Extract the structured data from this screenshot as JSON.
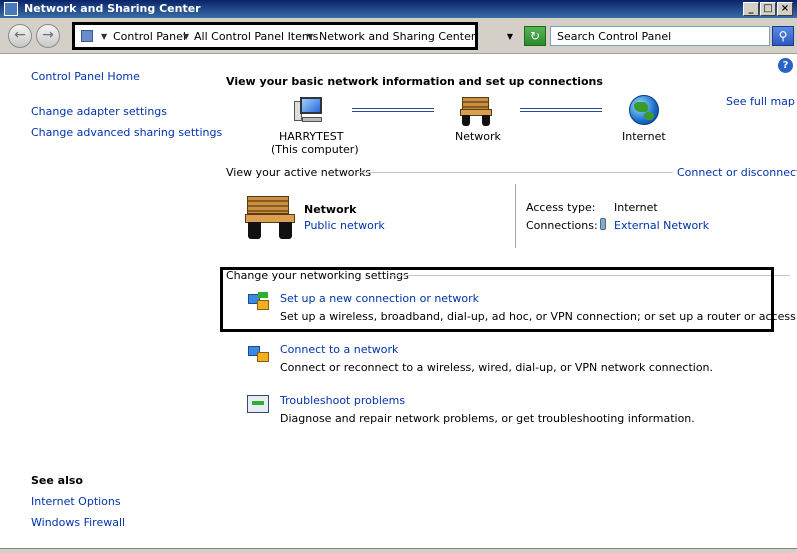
{
  "window": {
    "title": "Network and Sharing Center",
    "minimize": "_",
    "maximize": "□",
    "close": "×"
  },
  "address": {
    "crumbs": [
      "Control Panel",
      "All Control Panel Items",
      "Network and Sharing Center"
    ],
    "search_placeholder": "Search Control Panel"
  },
  "sidebar": {
    "home": "Control Panel Home",
    "items": [
      "Change adapter settings",
      "Change advanced sharing settings"
    ],
    "see_also_title": "See also",
    "see_also": [
      "Internet Options",
      "Windows Firewall"
    ]
  },
  "main": {
    "heading": "View your basic network information and set up connections",
    "see_full_map": "See full map",
    "map": {
      "computer_name": "HARRYTEST",
      "computer_sub": "(This computer)",
      "network": "Network",
      "internet": "Internet"
    },
    "active_title": "View your active networks",
    "connect_disconnect": "Connect or disconnect",
    "active": {
      "name": "Network",
      "type": "Public network",
      "access_label": "Access type:",
      "access_value": "Internet",
      "connections_label": "Connections:",
      "connections_value": "External Network"
    },
    "settings_title": "Change your networking settings",
    "tasks": [
      {
        "title": "Set up a new connection or network",
        "desc": "Set up a wireless, broadband, dial-up, ad hoc, or VPN connection; or set up a router or access point."
      },
      {
        "title": "Connect to a network",
        "desc": "Connect or reconnect to a wireless, wired, dial-up, or VPN network connection."
      },
      {
        "title": "Troubleshoot problems",
        "desc": "Diagnose and repair network problems, or get troubleshooting information."
      }
    ]
  },
  "colors": {
    "link": "#0033aa",
    "titlebar": "#0a246a"
  }
}
